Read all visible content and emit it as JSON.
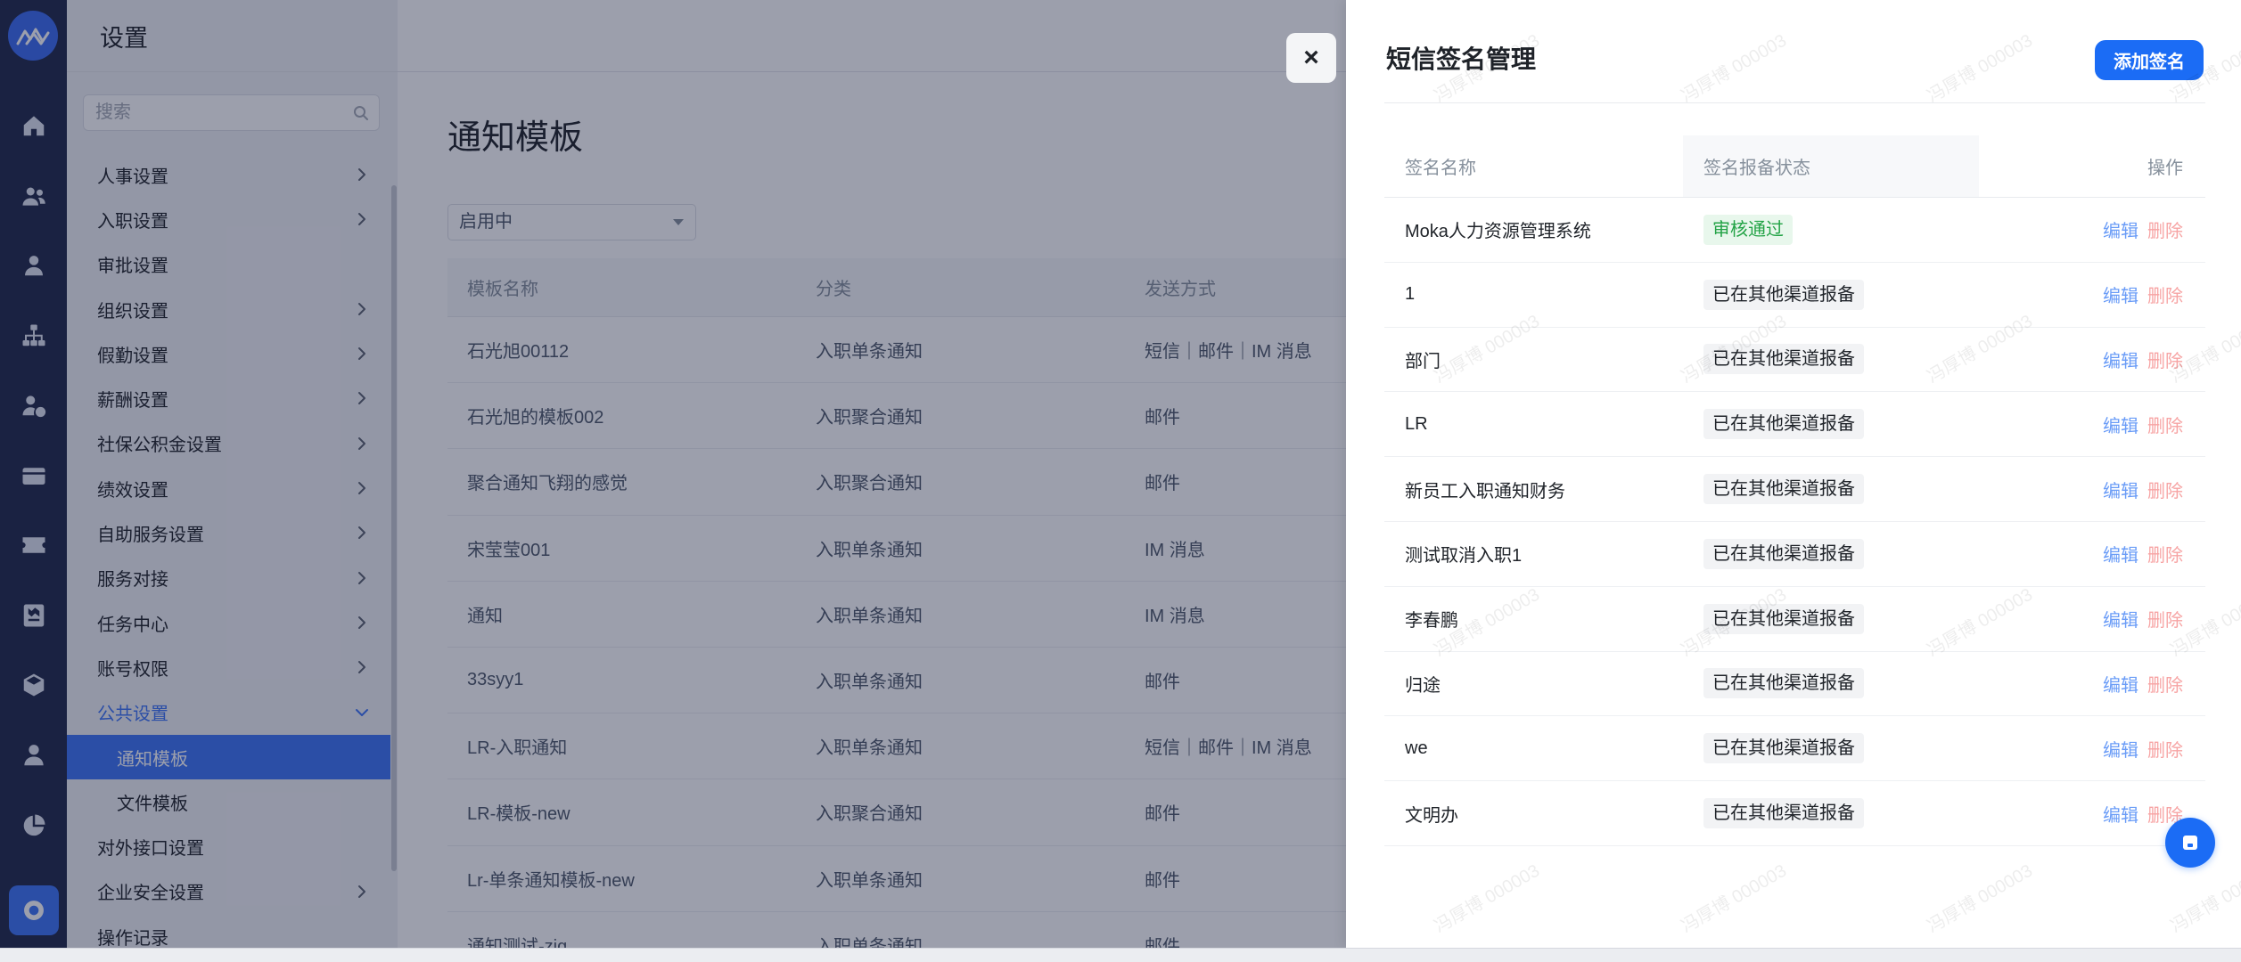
{
  "rail": {
    "logo": "moka-logo-icon",
    "items": [
      "home-icon",
      "team-icon",
      "user-icon",
      "org-chart-icon",
      "salary-icon",
      "card-icon",
      "ticket-icon",
      "report-icon",
      "cube-icon",
      "profile-icon",
      "pie-chart-icon",
      "settings-icon"
    ],
    "active": "settings-icon"
  },
  "settings": {
    "title": "设置",
    "search_placeholder": "搜索",
    "search_icon": "search-icon",
    "menu": [
      {
        "label": "人事设置",
        "icon": "chevron-right-icon"
      },
      {
        "label": "入职设置",
        "icon": "chevron-right-icon"
      },
      {
        "label": "审批设置"
      },
      {
        "label": "组织设置",
        "icon": "chevron-right-icon"
      },
      {
        "label": "假勤设置",
        "icon": "chevron-right-icon"
      },
      {
        "label": "薪酬设置",
        "icon": "chevron-right-icon"
      },
      {
        "label": "社保公积金设置",
        "icon": "chevron-right-icon"
      },
      {
        "label": "绩效设置",
        "icon": "chevron-right-icon"
      },
      {
        "label": "自助服务设置",
        "icon": "chevron-right-icon"
      },
      {
        "label": "服务对接",
        "icon": "chevron-right-icon"
      },
      {
        "label": "任务中心",
        "icon": "chevron-right-icon"
      },
      {
        "label": "账号权限",
        "icon": "chevron-right-icon"
      },
      {
        "label": "公共设置",
        "icon": "chevron-down-icon",
        "expanded": true,
        "children": [
          {
            "label": "通知模板",
            "selected": true
          },
          {
            "label": "文件模板"
          }
        ]
      },
      {
        "label": "对外接口设置"
      },
      {
        "label": "企业安全设置",
        "icon": "chevron-right-icon"
      },
      {
        "label": "操作记录"
      }
    ]
  },
  "main": {
    "title": "通知模板",
    "status_filter": "启用中",
    "columns": [
      "模板名称",
      "分类",
      "发送方式"
    ],
    "rows": [
      {
        "name": "石光旭00112",
        "category": "入职单条通知",
        "send_method": "短信｜邮件｜IM 消息"
      },
      {
        "name": "石光旭的模板002",
        "category": "入职聚合通知",
        "send_method": "邮件"
      },
      {
        "name": "聚合通知飞翔的感觉",
        "category": "入职聚合通知",
        "send_method": "邮件"
      },
      {
        "name": "宋莹莹001",
        "category": "入职单条通知",
        "send_method": "IM 消息"
      },
      {
        "name": "通知",
        "category": "入职单条通知",
        "send_method": "IM 消息"
      },
      {
        "name": "33syy1",
        "category": "入职单条通知",
        "send_method": "邮件"
      },
      {
        "name": "LR-入职通知",
        "category": "入职单条通知",
        "send_method": "短信｜邮件｜IM 消息"
      },
      {
        "name": "LR-模板-new",
        "category": "入职聚合通知",
        "send_method": "邮件"
      },
      {
        "name": "Lr-单条通知模板-new",
        "category": "入职单条通知",
        "send_method": "邮件"
      },
      {
        "name": "通知测试-zjg",
        "category": "入职单条通知",
        "send_method": "邮件"
      }
    ]
  },
  "drawer": {
    "close_label": "×",
    "title": "短信签名管理",
    "add_button": "添加签名",
    "columns": {
      "name": "签名名称",
      "status": "签名报备状态",
      "actions": "操作"
    },
    "actions": {
      "edit": "编辑",
      "delete": "删除"
    },
    "rows": [
      {
        "name": "Moka人力资源管理系统",
        "status": "审核通过",
        "tag_color": "green"
      },
      {
        "name": "1",
        "status": "已在其他渠道报备",
        "tag_color": "gray"
      },
      {
        "name": "部门",
        "status": "已在其他渠道报备",
        "tag_color": "gray"
      },
      {
        "name": "LR",
        "status": "已在其他渠道报备",
        "tag_color": "gray"
      },
      {
        "name": "新员工入职通知财务",
        "status": "已在其他渠道报备",
        "tag_color": "gray"
      },
      {
        "name": "测试取消入职1",
        "status": "已在其他渠道报备",
        "tag_color": "gray"
      },
      {
        "name": "李春鹏",
        "status": "已在其他渠道报备",
        "tag_color": "gray"
      },
      {
        "name": "归途",
        "status": "已在其他渠道报备",
        "tag_color": "gray"
      },
      {
        "name": "we",
        "status": "已在其他渠道报备",
        "tag_color": "gray"
      },
      {
        "name": "文明办",
        "status": "已在其他渠道报备",
        "tag_color": "gray"
      }
    ],
    "fab_icon": "inbox-icon"
  },
  "watermark": {
    "text": "冯厚博 000003"
  },
  "colors": {
    "primary": "#1b6cf5",
    "sidebar_selected": "#3d74f4",
    "approved_tag_bg": "#e8f7ec",
    "approved_tag_text": "#23a346",
    "neutral_tag_bg": "#f2f3f5",
    "edit_link": "#6a9cf7",
    "delete_link": "#f7a3a3",
    "rail_bg": "#202849",
    "overlay": "rgba(20,26,58,0.42)"
  }
}
